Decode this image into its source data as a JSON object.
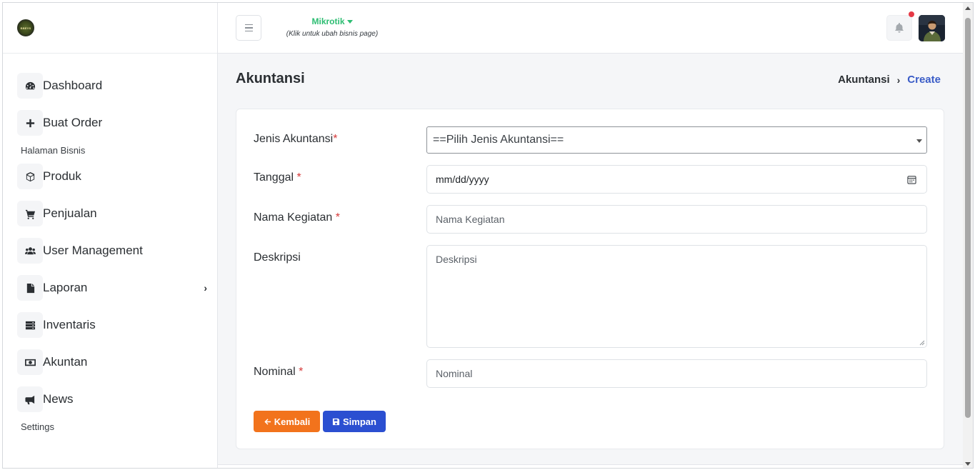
{
  "sidebar": {
    "logo_text": "BBEYS",
    "items": [
      {
        "label": "Dashboard",
        "icon": "dashboard-gauge-icon"
      },
      {
        "label": "Buat Order",
        "icon": "plus-icon"
      },
      {
        "label": "Produk",
        "icon": "box-icon"
      },
      {
        "label": "Penjualan",
        "icon": "cart-icon"
      },
      {
        "label": "User Management",
        "icon": "users-icon"
      },
      {
        "label": "Laporan",
        "icon": "file-icon",
        "arrow": "›"
      },
      {
        "label": "Inventaris",
        "icon": "server-icon"
      },
      {
        "label": "Akuntan",
        "icon": "money-bill-icon"
      },
      {
        "label": "News",
        "icon": "bullhorn-icon"
      }
    ],
    "sections": {
      "business_page": "Halaman Bisnis",
      "settings": "Settings"
    }
  },
  "topbar": {
    "business_name": "Mikrotik",
    "business_hint": "(Klik untuk ubah bisnis page)",
    "notification_badge_color": "#e63946"
  },
  "page": {
    "title": "Akuntansi",
    "breadcrumb": {
      "parent": "Akuntansi",
      "separator": "›",
      "current": "Create"
    }
  },
  "form": {
    "jenis_label": "Jenis Akuntansi",
    "jenis_value": "==Pilih Jenis Akuntansi==",
    "tanggal_label": "Tanggal",
    "tanggal_placeholder": "mm/dd/yyyy",
    "nama_label": "Nama Kegiatan",
    "nama_placeholder": "Nama Kegiatan",
    "deskripsi_label": "Deskripsi",
    "deskripsi_placeholder": "Deskripsi",
    "nominal_label": "Nominal",
    "nominal_placeholder": "Nominal",
    "required_mark": "*",
    "back_label": "Kembali",
    "save_label": "Simpan"
  },
  "colors": {
    "accent_green": "#2dbd72",
    "back_button": "#f2731c",
    "save_button": "#2b4fd1",
    "breadcrumb_active": "#3a5cc7",
    "required": "#d63a3a"
  }
}
